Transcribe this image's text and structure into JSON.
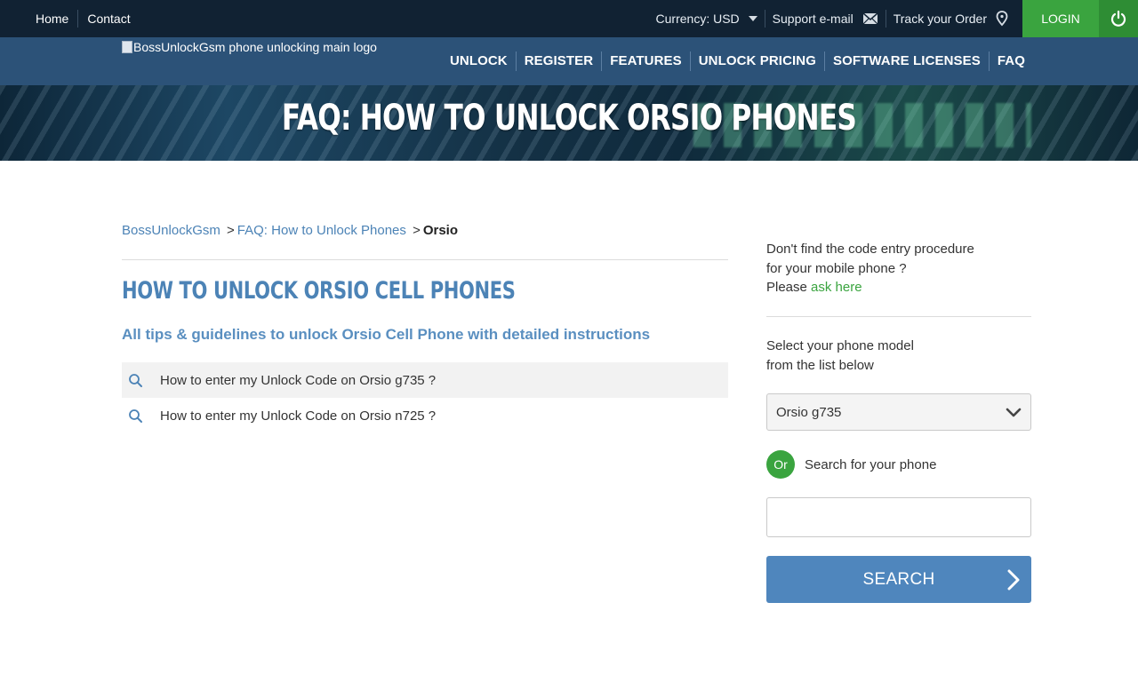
{
  "topbar": {
    "home": "Home",
    "contact": "Contact",
    "currency": "Currency: USD",
    "support": "Support e-mail",
    "track": "Track your Order",
    "login": "LOGIN"
  },
  "logo": {
    "alt": "BossUnlockGsm phone unlocking main logo"
  },
  "nav": {
    "items": [
      "UNLOCK",
      "REGISTER",
      "FEATURES",
      "UNLOCK PRICING",
      "SOFTWARE LICENSES",
      "FAQ"
    ]
  },
  "banner": {
    "title": "FAQ: HOW TO UNLOCK ORSIO PHONES"
  },
  "breadcrumb": {
    "home": "BossUnlockGsm",
    "sep1": ">",
    "faq": "FAQ: How to Unlock Phones",
    "sep2": ">",
    "current": "Orsio"
  },
  "main": {
    "title": "HOW TO UNLOCK ORSIO CELL PHONES",
    "subtitle": "All tips & guidelines to unlock Orsio Cell Phone with detailed instructions",
    "faq_items": [
      "How to enter my Unlock Code on Orsio g735 ?",
      "How to enter my Unlock Code on Orsio n725 ?"
    ]
  },
  "sidebar": {
    "help_line1": "Don't find the code entry procedure",
    "help_line2": "for your mobile phone ?",
    "help_please": "Please",
    "help_link": "ask here",
    "select_line1": "Select your phone model",
    "select_line2": "from the list below",
    "selected_model": "Orsio g735",
    "or_label": "Or",
    "search_label": "Search for your phone",
    "search_value": "",
    "search_button": "SEARCH"
  },
  "colors": {
    "topbar": "#112233",
    "navbar": "#2c5278",
    "accent_blue": "#4c83b6",
    "accent_green": "#3aa43f"
  }
}
